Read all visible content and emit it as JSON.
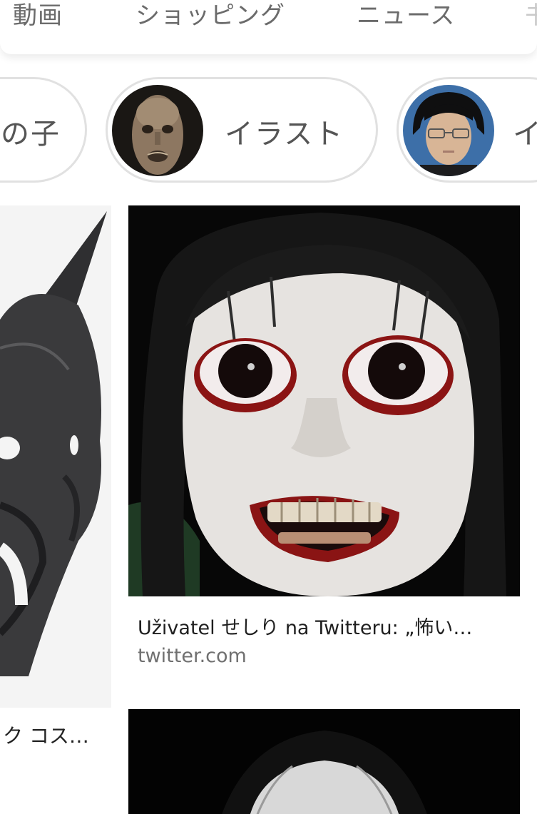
{
  "tabs": [
    "動画",
    "ショッピング",
    "ニュース",
    "书"
  ],
  "chips": [
    {
      "label": "の子"
    },
    {
      "label": "イラスト",
      "avatar": "mummy-face-thumbnail"
    },
    {
      "label": "イ",
      "avatar": "person-glasses-thumbnail"
    }
  ],
  "results": [
    {
      "caption": "ク コス…",
      "image": "oni-mask"
    },
    {
      "title": "Uživatel せしり na Twitteru: „怖い…",
      "source": "twitter.com",
      "image": "white-face-doll"
    },
    {
      "image": "dark-haired-figure"
    }
  ],
  "colors": {
    "tab_text": "#6b6b6b",
    "chip_border": "#e1e1e1",
    "source_text": "#707070"
  }
}
